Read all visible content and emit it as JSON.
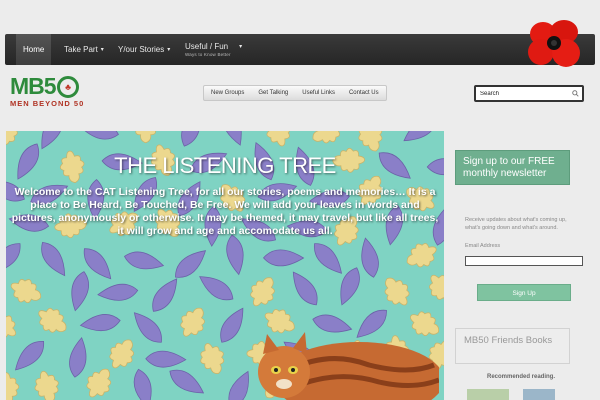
{
  "nav": {
    "items": [
      {
        "label": "Home",
        "active": true,
        "chevron": ""
      },
      {
        "label": "Take Part",
        "chevron": "▾"
      },
      {
        "label": "Y/our Stories",
        "chevron": "▾"
      },
      {
        "label": "Useful / Fun",
        "chevron": "▾",
        "sub": "Ways to Know Better"
      }
    ]
  },
  "logo": {
    "main": "MB5",
    "sub": "MEN BEYOND 50"
  },
  "submenu": [
    "New Groups",
    "Get Talking",
    "Useful Links",
    "Contact Us"
  ],
  "search": {
    "placeholder": "Search",
    "value": "Search"
  },
  "hero": {
    "title": "THE LISTENING TREE",
    "text": "Welcome to the CAT Listening Tree, for all our stories, poems and memories… It is a place to Be Heard, Be Touched, Be Free. We will add your leaves in words and pictures, anonymously or otherwise. It may be themed, it may travel, but like all trees, it will grow and age and accomodate us all."
  },
  "sidebar": {
    "newsletter_button": "Sign up to our FREE monthly newsletter",
    "newsletter_desc": "Receive updates about what's coming up, what's going down and what's around.",
    "email_label": "Email Address",
    "signup_label": "Sign Up",
    "friends_title": "MB50 Friends Books",
    "recommended": "Recommended reading."
  },
  "colors": {
    "brand_green": "#2e8b3c",
    "brand_red": "#b03324",
    "accent": "#6faf8f"
  }
}
